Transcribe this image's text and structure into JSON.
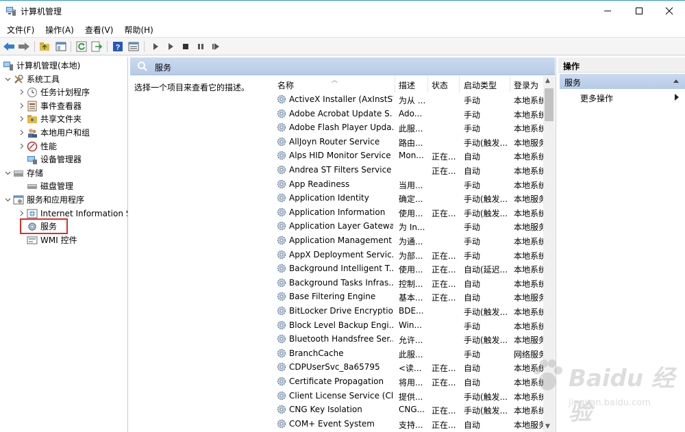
{
  "window": {
    "title": "计算机管理",
    "controls": [
      "minimize",
      "maximize",
      "close"
    ]
  },
  "menu": [
    "文件(F)",
    "操作(A)",
    "查看(V)",
    "帮助(H)"
  ],
  "toolbar_icons": [
    "back-arrow-icon",
    "forward-arrow-icon",
    "up-folder-icon",
    "show-hide-tree-icon",
    "refresh-icon",
    "export-list-icon",
    "help-icon",
    "properties-icon",
    "play-icon",
    "play-alt-icon",
    "stop-icon",
    "pause-icon",
    "restart-icon"
  ],
  "tree": {
    "root": "计算机管理(本地)",
    "system_tools": "系统工具",
    "task_scheduler": "任务计划程序",
    "event_viewer": "事件查看器",
    "shared_folders": "共享文件夹",
    "local_users": "本地用户和组",
    "performance": "性能",
    "device_manager": "设备管理器",
    "storage": "存储",
    "disk_management": "磁盘管理",
    "services_apps": "服务和应用程序",
    "iis": "Internet Information S",
    "services": "服务",
    "wmi": "WMI 控件"
  },
  "center": {
    "header": "服务",
    "description_prompt": "选择一个项目来查看它的描述。",
    "columns": [
      "名称",
      "描述",
      "状态",
      "启动类型",
      "登录为"
    ]
  },
  "services": [
    {
      "name": "ActiveX Installer (AxInstSV)",
      "desc": "为从 ...",
      "status": "",
      "startup": "手动",
      "logon": "本地系统"
    },
    {
      "name": "Adobe Acrobat Update S...",
      "desc": "Ado...",
      "status": "",
      "startup": "手动",
      "logon": "本地系统"
    },
    {
      "name": "Adobe Flash Player Upda...",
      "desc": "此服...",
      "status": "",
      "startup": "手动",
      "logon": "本地系统"
    },
    {
      "name": "AllJoyn Router Service",
      "desc": "路由...",
      "status": "",
      "startup": "手动(触发...",
      "logon": "本地服务"
    },
    {
      "name": "Alps HID Monitor Service",
      "desc": "Mon...",
      "status": "正在...",
      "startup": "自动",
      "logon": "本地系统"
    },
    {
      "name": "Andrea ST Filters Service",
      "desc": "",
      "status": "正在...",
      "startup": "自动",
      "logon": "本地系统"
    },
    {
      "name": "App Readiness",
      "desc": "当用...",
      "status": "",
      "startup": "手动",
      "logon": "本地系统"
    },
    {
      "name": "Application Identity",
      "desc": "确定...",
      "status": "",
      "startup": "手动(触发...",
      "logon": "本地服务"
    },
    {
      "name": "Application Information",
      "desc": "使用...",
      "status": "正在...",
      "startup": "手动(触发...",
      "logon": "本地系统"
    },
    {
      "name": "Application Layer Gatewa...",
      "desc": "为 In...",
      "status": "",
      "startup": "手动",
      "logon": "本地服务"
    },
    {
      "name": "Application Management",
      "desc": "为通...",
      "status": "",
      "startup": "手动",
      "logon": "本地系统"
    },
    {
      "name": "AppX Deployment Servic...",
      "desc": "为部...",
      "status": "正在...",
      "startup": "手动",
      "logon": "本地系统"
    },
    {
      "name": "Background Intelligent T...",
      "desc": "使用...",
      "status": "正在...",
      "startup": "自动(延迟...",
      "logon": "本地系统"
    },
    {
      "name": "Background Tasks Infras...",
      "desc": "控制...",
      "status": "正在...",
      "startup": "自动",
      "logon": "本地系统"
    },
    {
      "name": "Base Filtering Engine",
      "desc": "基本...",
      "status": "正在...",
      "startup": "自动",
      "logon": "本地服务"
    },
    {
      "name": "BitLocker Drive Encryptio...",
      "desc": "BDE...",
      "status": "",
      "startup": "手动(触发...",
      "logon": "本地系统"
    },
    {
      "name": "Block Level Backup Engi...",
      "desc": "Win...",
      "status": "",
      "startup": "手动",
      "logon": "本地系统"
    },
    {
      "name": "Bluetooth Handsfree Ser...",
      "desc": "允许...",
      "status": "",
      "startup": "手动(触发...",
      "logon": "本地服务"
    },
    {
      "name": "BranchCache",
      "desc": "此服...",
      "status": "",
      "startup": "手动",
      "logon": "网络服务"
    },
    {
      "name": "CDPUserSvc_8a65795",
      "desc": "<读...",
      "status": "正在...",
      "startup": "自动",
      "logon": "本地系统"
    },
    {
      "name": "Certificate Propagation",
      "desc": "将用...",
      "status": "正在...",
      "startup": "自动",
      "logon": "本地系统"
    },
    {
      "name": "Client License Service (Cli...",
      "desc": "提供...",
      "status": "",
      "startup": "手动(触发...",
      "logon": "本地系统"
    },
    {
      "name": "CNG Key Isolation",
      "desc": "CNG...",
      "status": "正在...",
      "startup": "手动(触发...",
      "logon": "本地系统"
    },
    {
      "name": "COM+ Event System",
      "desc": "支持...",
      "status": "正在...",
      "startup": "自动",
      "logon": "本地服务"
    }
  ],
  "actions": {
    "header": "操作",
    "section": "服务",
    "more": "更多操作"
  },
  "watermark": {
    "text": "Baidu 经验",
    "sub": "jingyan.baidu.com"
  }
}
